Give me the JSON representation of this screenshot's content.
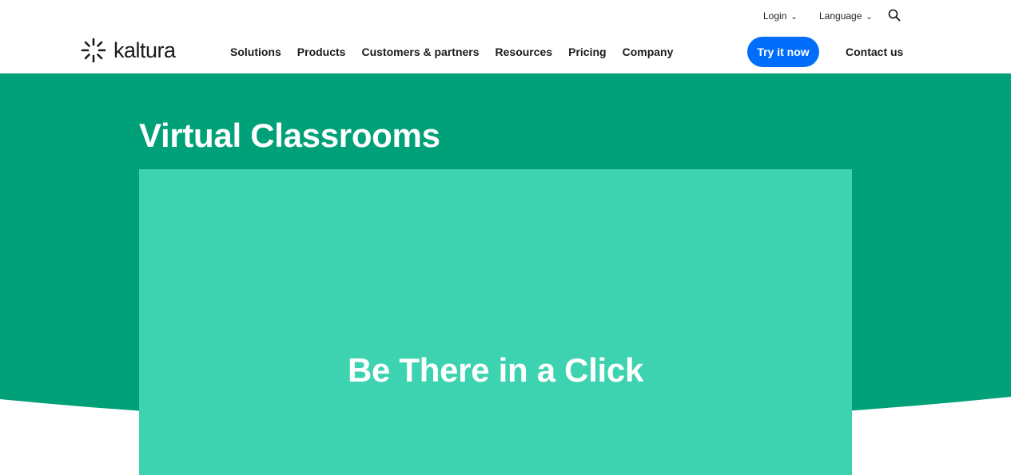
{
  "colors": {
    "hero_green": "#00a078",
    "media_teal": "#3dd3b0",
    "cta_blue": "#006efa",
    "text_dark": "#1b1b1b"
  },
  "utility": {
    "login_label": "Login",
    "language_label": "Language",
    "chevron": "⌄",
    "search_icon": "search-icon"
  },
  "brand": {
    "logo_text": "kaltura",
    "logo_icon": "kaltura-burst-icon"
  },
  "nav": {
    "items": [
      {
        "label": "Solutions"
      },
      {
        "label": "Products"
      },
      {
        "label": "Customers & partners"
      },
      {
        "label": "Resources"
      },
      {
        "label": "Pricing"
      },
      {
        "label": "Company"
      }
    ],
    "cta_label": "Try it now",
    "contact_label": "Contact us"
  },
  "hero": {
    "title": "Virtual Classrooms",
    "media_headline": "Be There in a Click"
  }
}
